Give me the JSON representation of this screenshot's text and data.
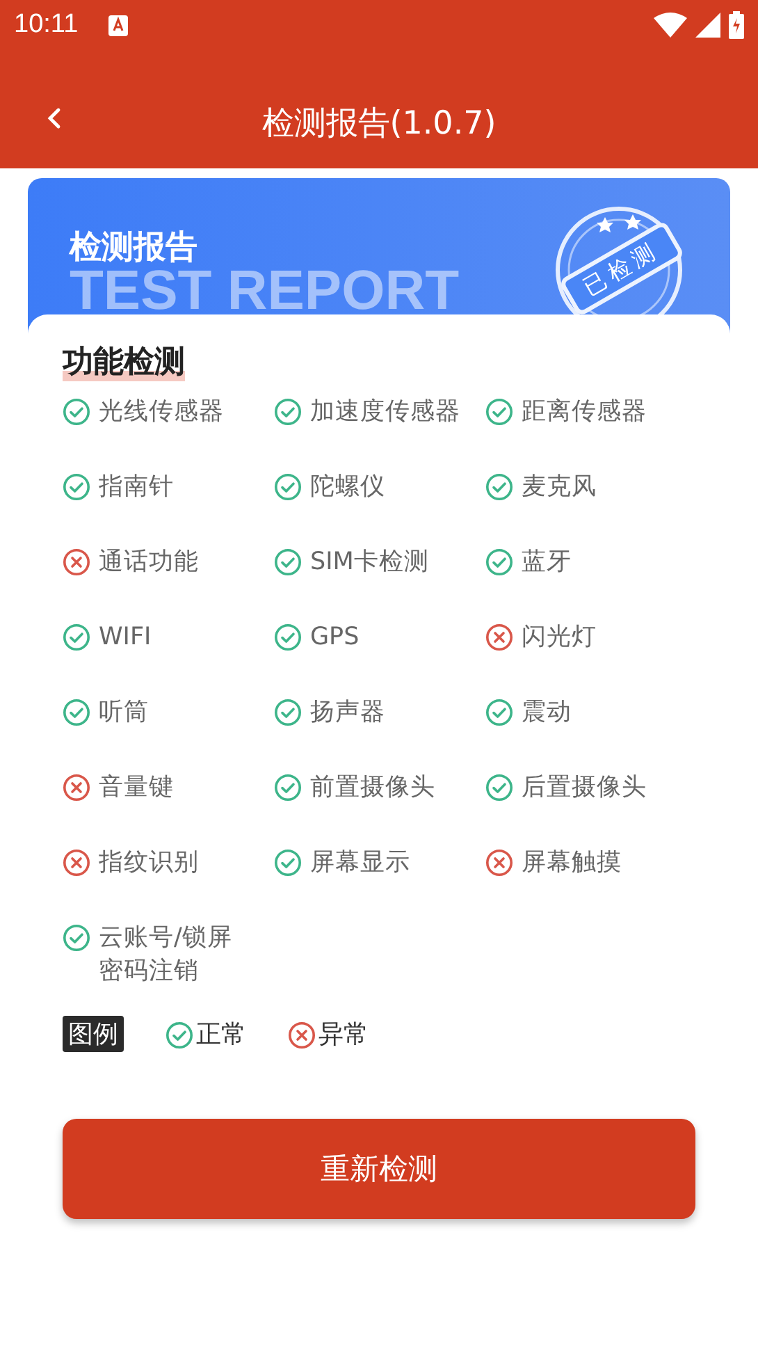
{
  "status_bar": {
    "time": "10:11"
  },
  "app_bar": {
    "title": "检测报告(1.0.7)"
  },
  "banner": {
    "title": "检测报告",
    "watermark": "TEST REPORT",
    "stamp": "已检测"
  },
  "section": {
    "title": "功能检测"
  },
  "items": [
    {
      "name": "光线传感器",
      "passed": true
    },
    {
      "name": "加速度传感器",
      "passed": true
    },
    {
      "name": "距离传感器",
      "passed": true
    },
    {
      "name": "指南针",
      "passed": true
    },
    {
      "name": "陀螺仪",
      "passed": true
    },
    {
      "name": "麦克风",
      "passed": true
    },
    {
      "name": "通话功能",
      "passed": false
    },
    {
      "name": "SIM卡检测",
      "passed": true
    },
    {
      "name": "蓝牙",
      "passed": true
    },
    {
      "name": "WIFI",
      "passed": true
    },
    {
      "name": "GPS",
      "passed": true
    },
    {
      "name": "闪光灯",
      "passed": false
    },
    {
      "name": "听筒",
      "passed": true
    },
    {
      "name": "扬声器",
      "passed": true
    },
    {
      "name": "震动",
      "passed": true
    },
    {
      "name": "音量键",
      "passed": false
    },
    {
      "name": "前置摄像头",
      "passed": true
    },
    {
      "name": "后置摄像头",
      "passed": true
    },
    {
      "name": "指纹识别",
      "passed": false
    },
    {
      "name": "屏幕显示",
      "passed": true
    },
    {
      "name": "屏幕触摸",
      "passed": false
    },
    {
      "name": "云账号/锁屏密码注销",
      "passed": true
    }
  ],
  "legend": {
    "label": "图例",
    "items": [
      {
        "name": "正常",
        "passed": true
      },
      {
        "name": "异常",
        "passed": false
      }
    ]
  },
  "button": {
    "label": "重新检测"
  }
}
